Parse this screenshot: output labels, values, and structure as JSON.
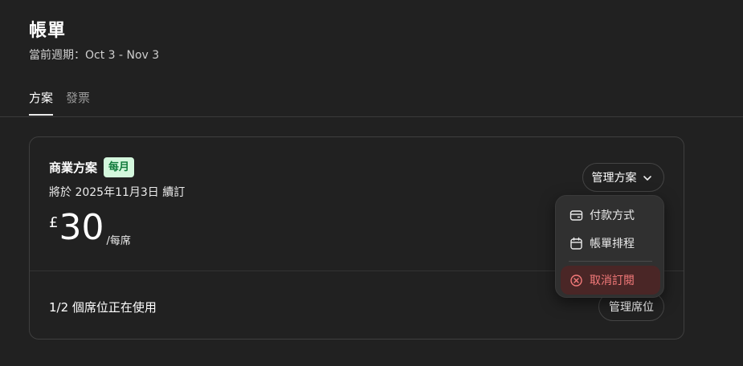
{
  "page": {
    "title": "帳單",
    "period": "當前週期：Oct 3 - Nov 3"
  },
  "tabs": [
    {
      "label": "方案",
      "active": true
    },
    {
      "label": "發票",
      "active": false
    }
  ],
  "plan": {
    "name": "商業方案",
    "badge": "每月",
    "renewal": "將於 2025年11月3日 續訂",
    "currency": "£",
    "amount": "30",
    "per": "/每席",
    "manage_label": "管理方案"
  },
  "seats": {
    "usage": "1/2 個席位正在使用",
    "manage_label": "管理席位"
  },
  "menu": {
    "items": [
      {
        "label": "付款方式",
        "icon": "credit-card-icon"
      },
      {
        "label": "帳單排程",
        "icon": "calendar-icon"
      },
      {
        "label": "取消訂閱",
        "icon": "cancel-circle-icon"
      }
    ]
  },
  "colors": {
    "background": "#212121",
    "badge_bg": "#d4f7dd",
    "badge_text": "#0f7a3a",
    "danger": "#f47a7a",
    "danger_bg": "#4a2626"
  }
}
